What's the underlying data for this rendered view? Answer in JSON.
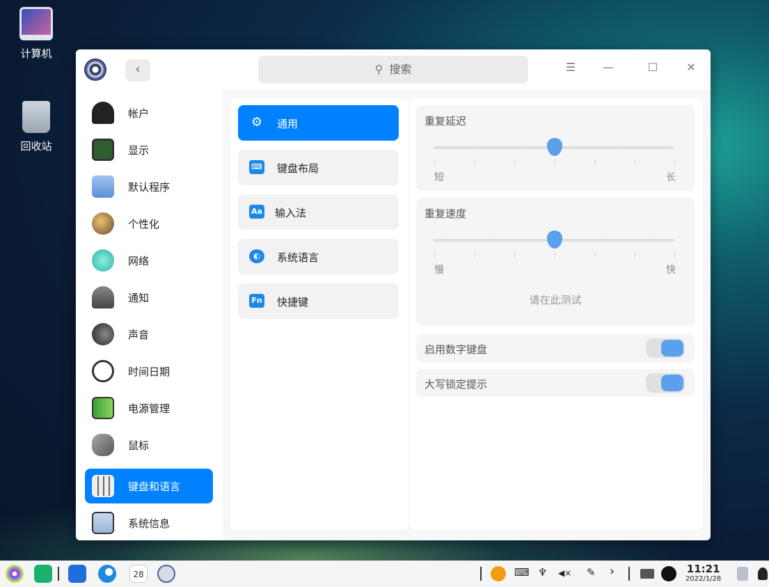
{
  "desktop": {
    "icons": [
      {
        "label": "计算机"
      },
      {
        "label": "回收站"
      }
    ]
  },
  "titlebar": {
    "back_label": "‹",
    "search_placeholder": "搜索",
    "menu_glyph": "☰",
    "minimize_glyph": "—",
    "maximize_glyph": "☐",
    "close_glyph": "✕"
  },
  "sidebar": {
    "items": [
      {
        "label": "帐户",
        "icon": "account-icon",
        "color": "#222222"
      },
      {
        "label": "显示",
        "icon": "display-icon",
        "color": "#2f5d2f"
      },
      {
        "label": "默认程序",
        "icon": "default-apps-icon",
        "color": "#5b8fd6"
      },
      {
        "label": "个性化",
        "icon": "personalization-icon",
        "color": "#6b4a3a"
      },
      {
        "label": "网络",
        "icon": "network-icon",
        "color": "#2db3a6"
      },
      {
        "label": "通知",
        "icon": "notification-icon",
        "color": "#555555"
      },
      {
        "label": "声音",
        "icon": "sound-icon",
        "color": "#333333"
      },
      {
        "label": "时间日期",
        "icon": "clock-icon",
        "color": "#cccccc"
      },
      {
        "label": "电源管理",
        "icon": "battery-icon",
        "color": "#5cb85c"
      },
      {
        "label": "鼠标",
        "icon": "mouse-icon",
        "color": "#777777"
      },
      {
        "label": "键盘和语言",
        "icon": "keyboard-language-icon",
        "color": "#dddddd"
      },
      {
        "label": "系统信息",
        "icon": "system-info-icon",
        "color": "#9bb4d6"
      }
    ],
    "active_index": 10
  },
  "submenu": {
    "items": [
      {
        "label": "通用",
        "icon": "gear-icon",
        "glyph": "⚙"
      },
      {
        "label": "键盘布局",
        "icon": "keyboard-icon",
        "glyph": "⌨"
      },
      {
        "label": "输入法",
        "icon": "input-method-icon",
        "glyph": "Aa"
      },
      {
        "label": "系统语言",
        "icon": "language-icon",
        "glyph": "◐"
      },
      {
        "label": "快捷键",
        "icon": "shortcut-icon",
        "glyph": "Fn"
      }
    ],
    "active_index": 0
  },
  "settings": {
    "repeat_delay": {
      "title": "重复延迟",
      "min_label": "短",
      "max_label": "长",
      "value": 0.5
    },
    "repeat_rate": {
      "title": "重复速度",
      "min_label": "慢",
      "max_label": "快",
      "value": 0.5,
      "test_placeholder": "请在此测试"
    },
    "numlock": {
      "label": "启用数字键盘",
      "enabled": true
    },
    "capslock_hint": {
      "label": "大写锁定提示",
      "enabled": true
    }
  },
  "taskbar": {
    "calendar_day": "28",
    "tray_glyphs": {
      "keyboard": "⌨",
      "usb": "♆",
      "volume": "◀×",
      "pen": "✎",
      "expand": "›"
    },
    "time": "11:21",
    "date": "2022/1/28"
  }
}
